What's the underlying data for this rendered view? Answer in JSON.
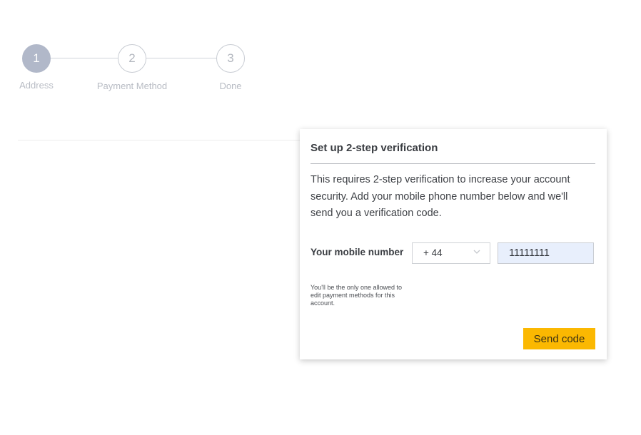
{
  "stepper": {
    "steps": [
      {
        "number": "1",
        "label": "Address",
        "state": "active"
      },
      {
        "number": "2",
        "label": "Payment Method",
        "state": "inactive"
      },
      {
        "number": "3",
        "label": "Done",
        "state": "inactive"
      }
    ]
  },
  "modal": {
    "title": "Set up 2-step verification",
    "description": "This requires 2-step verification to increase your account security. Add your mobile phone number below and we'll send you a verification code.",
    "phone_label": "Your mobile number",
    "country_code": {
      "selected": "+ 44",
      "icon": "chevron-down-icon"
    },
    "phone_input": {
      "value": "11111111"
    },
    "helper_text": "You'll be the only one allowed to edit payment methods for this account.",
    "send_button_label": "Send code"
  },
  "colors": {
    "accent": "#fbb801",
    "step_active": "#b1b8c9",
    "input_fill": "#e8effc"
  }
}
